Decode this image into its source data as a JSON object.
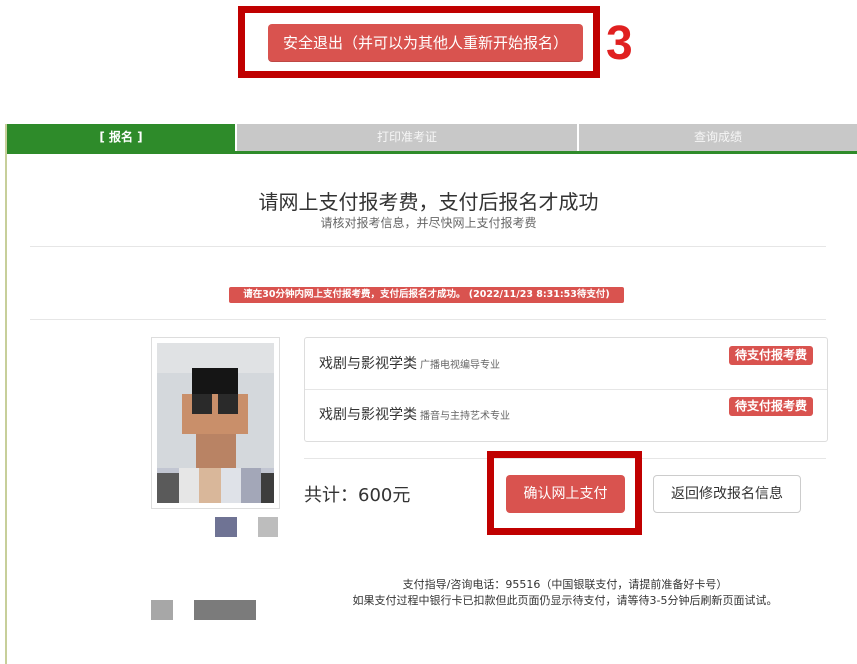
{
  "logout": {
    "label": "安全退出（并可以为其他人重新开始报名）"
  },
  "annotation": {
    "step_number": "3"
  },
  "tabs": [
    {
      "label": "[ 报名 ]",
      "active": true
    },
    {
      "label": "打印准考证",
      "active": false
    },
    {
      "label": "查询成绩",
      "active": false
    }
  ],
  "header": {
    "title": "请网上支付报考费，支付后报名才成功",
    "subtitle": "请核对报考信息，并尽快网上支付报考费"
  },
  "warning": {
    "text": "请在30分钟内网上支付报考费，支付后报名才成功。 (2022/11/23 8:31:53待支付)"
  },
  "majors": [
    {
      "category": "戏剧与影视学类",
      "specialty": "广播电视编导专业",
      "status": "待支付报考费"
    },
    {
      "category": "戏剧与影视学类",
      "specialty": "播音与主持艺术专业",
      "status": "待支付报考费"
    }
  ],
  "payment": {
    "total_label": "共计：600元",
    "confirm_label": "确认网上支付",
    "back_label": "返回修改报名信息"
  },
  "help": {
    "line1": "支付指导/咨询电话：95516（中国银联支付，请提前准备好卡号）",
    "line2": "如果支付过程中银行卡已扣款但此页面仍显示待支付，请等待3-5分钟后刷新页面试试。"
  },
  "colors": {
    "accent_red": "#d9534f",
    "active_tab": "#2e8b2a",
    "inactive_tab": "#c8c8c8",
    "annotation": "#c00000"
  }
}
